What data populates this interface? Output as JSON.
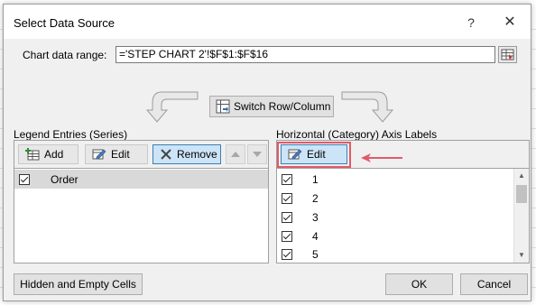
{
  "dialog": {
    "title": "Select Data Source",
    "help_icon": "?",
    "close_icon": "✕"
  },
  "range": {
    "label": "Chart data range:",
    "value": "='STEP CHART 2'!$F$1:$F$16"
  },
  "switch": {
    "label": "Switch Row/Column"
  },
  "legend": {
    "header": "Legend Entries (Series)",
    "add_label": "Add",
    "edit_label": "Edit",
    "remove_label": "Remove",
    "items": [
      {
        "label": "Order",
        "checked": true
      }
    ]
  },
  "axis": {
    "header": "Horizontal (Category) Axis Labels",
    "edit_label": "Edit",
    "items": [
      {
        "label": "1",
        "checked": true
      },
      {
        "label": "2",
        "checked": true
      },
      {
        "label": "3",
        "checked": true
      },
      {
        "label": "4",
        "checked": true
      },
      {
        "label": "5",
        "checked": true
      }
    ]
  },
  "buttons": {
    "hidden_label": "Hidden and Empty Cells",
    "ok_label": "OK",
    "cancel_label": "Cancel"
  },
  "colors": {
    "highlight": "#e05a6a",
    "selected_button": "#cce4f7",
    "selected_border": "#3c7fb1"
  },
  "icons": {
    "add": "add-table-icon",
    "edit": "edit-pencil-icon",
    "remove": "remove-x-icon",
    "move_up": "triangle-up-icon",
    "move_down": "triangle-down-icon",
    "switch": "switch-row-column-icon",
    "range_picker": "range-picker-icon"
  }
}
